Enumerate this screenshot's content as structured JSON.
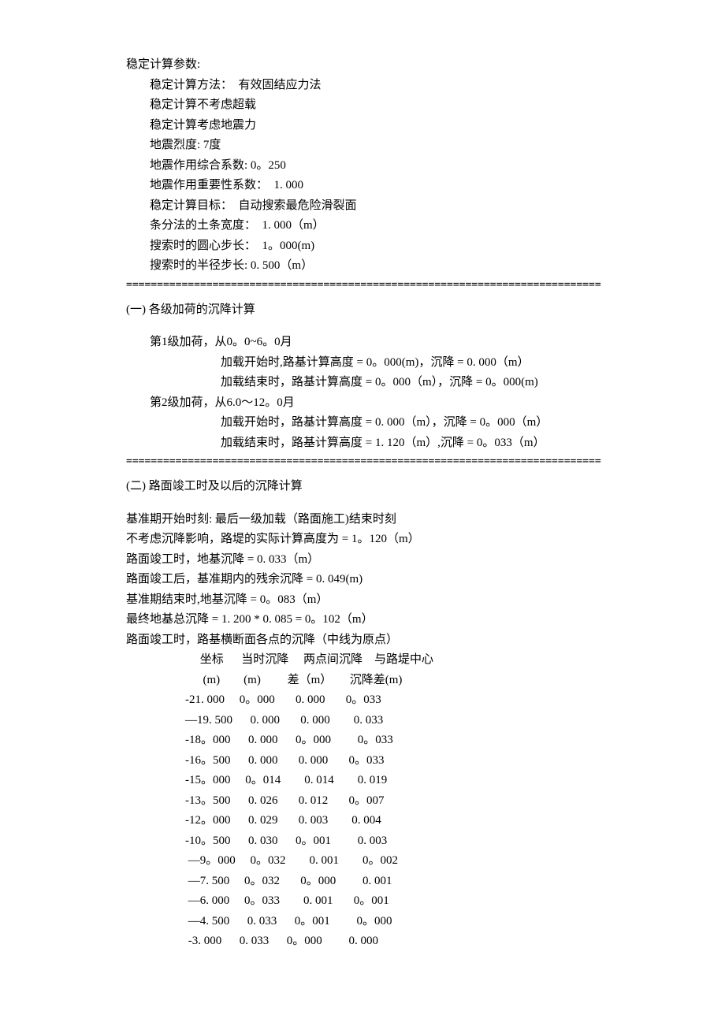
{
  "params": {
    "heading": "稳定计算参数:",
    "method": "稳定计算方法：  有效固结应力法",
    "no_overload": "稳定计算不考虑超载",
    "seismic": "稳定计算考虑地震力",
    "intensity": "地震烈度: 7度",
    "coef": "地震作用综合系数: 0。250",
    "importance": "地震作用重要性系数：  1. 000",
    "target": "稳定计算目标：  自动搜索最危险滑裂面",
    "strip": "条分法的土条宽度：  1. 000（m）",
    "center_step": "搜索时的圆心步长：  1。000(m)",
    "radius_step": "搜索时的半径步长: 0. 500（m）"
  },
  "separator1": "=============================================================================",
  "sec1": {
    "title": "(一)  各级加荷的沉降计算",
    "l1": {
      "head": "第1级加荷，从0。0~6。0月",
      "start": "加载开始时,路基计算高度 = 0。000(m)，沉降 = 0. 000（m）",
      "end": "加载结束时，路基计算高度 = 0。000（m），沉降 = 0。000(m)"
    },
    "l2": {
      "head": "第2级加荷，从6.0～12。0月",
      "start": "加载开始时，路基计算高度 = 0. 000（m），沉降 = 0。000（m）",
      "end": "加载结束时，路基计算高度 = 1. 120（m）,沉降 = 0。033（m）"
    }
  },
  "separator2": "=============================================================================",
  "sec2": {
    "title": "(二)  路面竣工时及以后的沉降计算",
    "lines": {
      "a": "基准期开始时刻: 最后一级加载（路面施工)结束时刻",
      "b": "不考虑沉降影响，路堤的实际计算高度为 = 1。120（m）",
      "c": "路面竣工时，地基沉降 = 0. 033（m）",
      "d": "路面竣工后，基准期内的残余沉降 = 0. 049(m)",
      "e": "基准期结束时,地基沉降 = 0。083（m）",
      "f": "最终地基总沉降 = 1. 200 * 0. 085 = 0。102（m）",
      "g": "路面竣工时，路基横断面各点的沉降（中线为原点）"
    },
    "th1": " 坐标      当时沉降     两点间沉降    与路堤中心",
    "th2": "  (m)        (m)         差（m）      沉降差(m)",
    "rows": [
      "-21. 000     0。000       0. 000       0。033",
      "—19. 500      0. 000       0. 000        0. 033",
      "-18。000      0. 000      0。000         0。033",
      "-16。500      0. 000       0. 000       0。033",
      "-15。000     0。014        0. 014        0. 019",
      "-13。500      0. 026       0. 012       0。007",
      "-12。000      0. 029       0. 003        0. 004",
      "-10。500      0. 030      0。001         0. 003",
      " —9。000     0。032        0. 001        0。002",
      " —7. 500     0。032       0。000         0. 001",
      " —6. 000     0。033        0. 001       0。001",
      " —4. 500      0. 033      0。001         0。000",
      " -3. 000      0. 033      0。000         0. 000"
    ]
  },
  "chart_data": {
    "type": "table",
    "title": "路面竣工时，路基横断面各点的沉降（中线为原点）",
    "columns": [
      "坐标 (m)",
      "当时沉降 (m)",
      "两点间沉降差 (m)",
      "与路堤中心沉降差 (m)"
    ],
    "rows": [
      [
        -21.0,
        0.0,
        0.0,
        0.033
      ],
      [
        -19.5,
        0.0,
        0.0,
        0.033
      ],
      [
        -18.0,
        0.0,
        0.0,
        0.033
      ],
      [
        -16.5,
        0.0,
        0.0,
        0.033
      ],
      [
        -15.0,
        0.014,
        0.014,
        0.019
      ],
      [
        -13.5,
        0.026,
        0.012,
        0.007
      ],
      [
        -12.0,
        0.029,
        0.003,
        0.004
      ],
      [
        -10.5,
        0.03,
        0.001,
        0.003
      ],
      [
        -9.0,
        0.032,
        0.001,
        0.002
      ],
      [
        -7.5,
        0.032,
        0.0,
        0.001
      ],
      [
        -6.0,
        0.033,
        0.001,
        0.001
      ],
      [
        -4.5,
        0.033,
        0.001,
        0.0
      ],
      [
        -3.0,
        0.033,
        0.0,
        0.0
      ]
    ]
  }
}
